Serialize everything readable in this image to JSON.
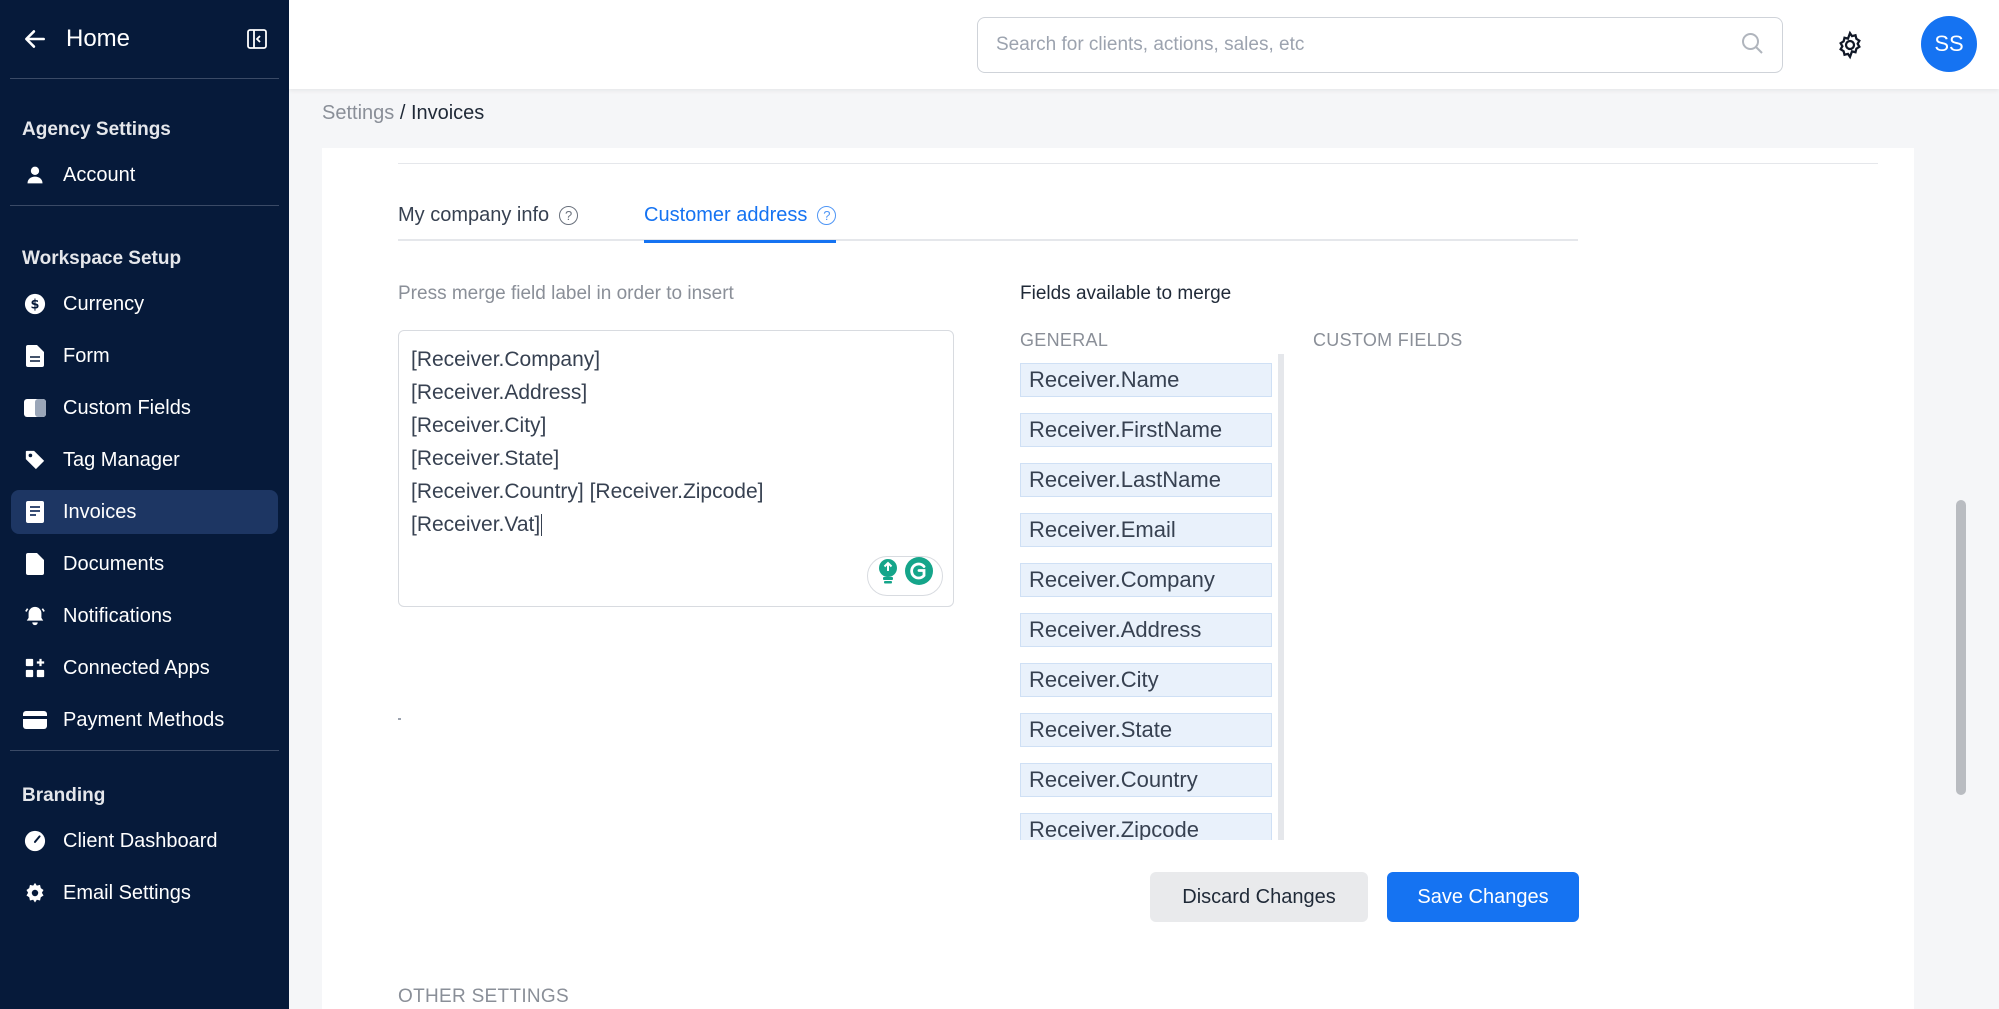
{
  "sidebar": {
    "home_label": "Home",
    "sections": {
      "agency": "Agency Settings",
      "workspace": "Workspace Setup",
      "branding": "Branding"
    },
    "items": {
      "account": "Account",
      "currency": "Currency",
      "form": "Form",
      "custom_fields": "Custom Fields",
      "tag_manager": "Tag Manager",
      "invoices": "Invoices",
      "documents": "Documents",
      "notifications": "Notifications",
      "connected_apps": "Connected Apps",
      "payment_methods": "Payment Methods",
      "client_dashboard": "Client Dashboard",
      "email_settings": "Email Settings"
    },
    "active_item": "invoices"
  },
  "header": {
    "search_placeholder": "Search for clients, actions, sales, etc",
    "avatar_initials": "SS"
  },
  "breadcrumb": {
    "root": "Settings",
    "separator": " / ",
    "current": "Invoices"
  },
  "tabs": {
    "my_company": "My company info",
    "customer_address": "Customer address",
    "active": "customer_address"
  },
  "editor": {
    "hint": "Press merge field label in order to insert",
    "lines": [
      "[Receiver.Company]",
      "[Receiver.Address]",
      "[Receiver.City]",
      "[Receiver.State]",
      "[Receiver.Country] [Receiver.Zipcode]",
      "[Receiver.Vat]"
    ]
  },
  "merge_fields": {
    "title": "Fields available to merge",
    "general_header": "GENERAL",
    "custom_header": "CUSTOM FIELDS",
    "general": [
      "Receiver.Name",
      "Receiver.FirstName",
      "Receiver.LastName",
      "Receiver.Email",
      "Receiver.Company",
      "Receiver.Address",
      "Receiver.City",
      "Receiver.State",
      "Receiver.Country",
      "Receiver.Zipcode"
    ]
  },
  "actions": {
    "discard": "Discard Changes",
    "save": "Save Changes"
  },
  "other_settings_header": "OTHER SETTINGS",
  "colors": {
    "sidebar_bg": "#061a3a",
    "sidebar_active": "#1d3663",
    "accent": "#1573f2",
    "chip_bg": "#e9f1fb"
  }
}
